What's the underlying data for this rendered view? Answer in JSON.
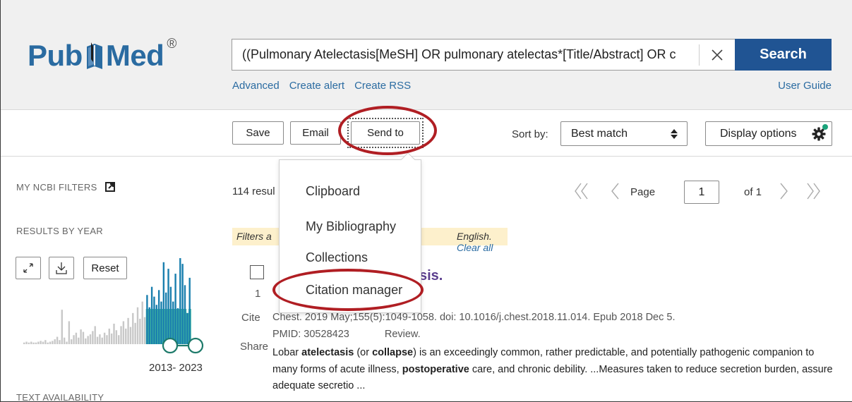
{
  "header": {
    "logo_left": "Pub",
    "logo_right": "Med",
    "logo_mark": "®",
    "search_value": "((Pulmonary Atelectasis[MeSH] OR pulmonary atelectas*[Title/Abstract] OR c",
    "search_button": "Search",
    "links": [
      "Advanced",
      "Create alert",
      "Create RSS"
    ],
    "user_guide": "User Guide"
  },
  "toolbar": {
    "save": "Save",
    "email": "Email",
    "send_to": "Send to",
    "sort_by_label": "Sort by:",
    "sort_value": "Best match",
    "display_options": "Display options"
  },
  "send_to_menu": {
    "items": [
      "Clipboard",
      "My Bibliography",
      "Collections",
      "Citation manager"
    ]
  },
  "sidebar": {
    "my_ncbi_filters": "MY NCBI FILTERS",
    "results_by_year": "RESULTS BY YEAR",
    "reset": "Reset",
    "year_range": "2013- 2023",
    "text_availability": "TEXT AVAILABILITY"
  },
  "results": {
    "count_text": "114 resul",
    "page_label": "Page",
    "page_value": "1",
    "of_pages": "of 1",
    "filters_left": "Filters a",
    "filters_right": "English.",
    "clear_all": "Clear all"
  },
  "result_item": {
    "number": "1",
    "title_tail": "sis.",
    "cite": "Cite",
    "share": "Share",
    "journal": "Chest. 2019 May;155(5):1049-1058. doi: 10.1016/j.chest.2018.11.014. Epub 2018 Dec 5.",
    "pmid": "PMID: 30528423",
    "pub_type": "Review.",
    "snippet": [
      {
        "t": "Lobar ",
        "b": false
      },
      {
        "t": "atelectasis",
        "b": true
      },
      {
        "t": " (or ",
        "b": false
      },
      {
        "t": "collapse",
        "b": true
      },
      {
        "t": ") is an exceedingly common, rather predictable, and potentially pathogenic companion to many forms of acute illness, ",
        "b": false
      },
      {
        "t": "postoperative",
        "b": true
      },
      {
        "t": " care, and chronic debility. ...Measures taken to reduce secretion burden, assure adequate secretio ...",
        "b": false
      }
    ]
  },
  "histogram": {
    "values": [
      2,
      3,
      2,
      3,
      2,
      2,
      3,
      4,
      3,
      5,
      2,
      3,
      4,
      6,
      9,
      5,
      42,
      8,
      3,
      28,
      6,
      11,
      14,
      8,
      18,
      15,
      7,
      10,
      12,
      16,
      22,
      9,
      12,
      8,
      14,
      11,
      19,
      13,
      25,
      17,
      11,
      22,
      28,
      19,
      32,
      21,
      38,
      26,
      45,
      31,
      52,
      33,
      60,
      45,
      70,
      58,
      48,
      66,
      52,
      100,
      63,
      92,
      70,
      52,
      86,
      44,
      105,
      98,
      72,
      38,
      81
    ],
    "selected_from": 52,
    "bar_color": "#c8c8c8",
    "selected_color": "#1a7fae",
    "fill_color": "#44bba0"
  },
  "colors": {
    "brand": "#2a6ba1",
    "search_button": "#205493",
    "annotation": "#b01e23"
  }
}
